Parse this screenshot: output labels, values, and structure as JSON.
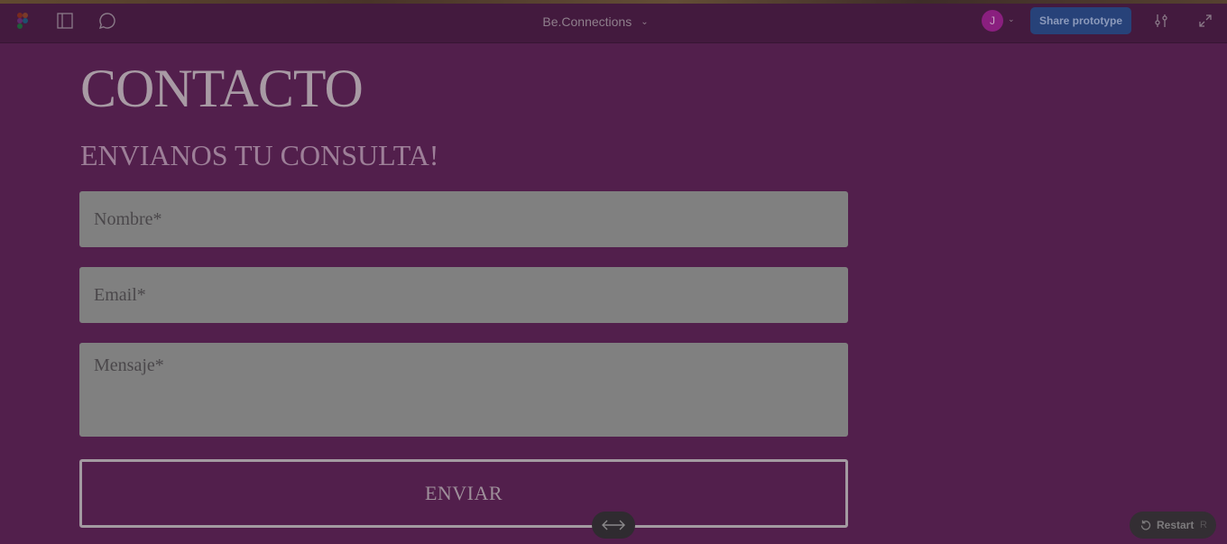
{
  "toolbar": {
    "file_name": "Be.Connections",
    "avatar_initial": "J",
    "share_label": "Share prototype",
    "icons": {
      "logo": "figma-logo-icon",
      "panel": "sidebar-panel-icon",
      "comment": "comment-bubble-icon",
      "settings": "sliders-icon",
      "expand": "expand-arrows-icon"
    },
    "colors": {
      "share_bg": "#274279",
      "avatar_bg": "#8a1f7f"
    }
  },
  "page": {
    "heading": "CONTACTO",
    "subheading": "ENVIANOS TU CONSULTA!",
    "form": {
      "name_placeholder": "Nombre*",
      "email_placeholder": "Email*",
      "message_placeholder": "Mensaje*",
      "submit_label": "ENVIAR"
    },
    "colors": {
      "background": "#521f4c",
      "field_bg": "#808080"
    }
  },
  "controls": {
    "restart_label": "Restart",
    "restart_shortcut": "R"
  }
}
